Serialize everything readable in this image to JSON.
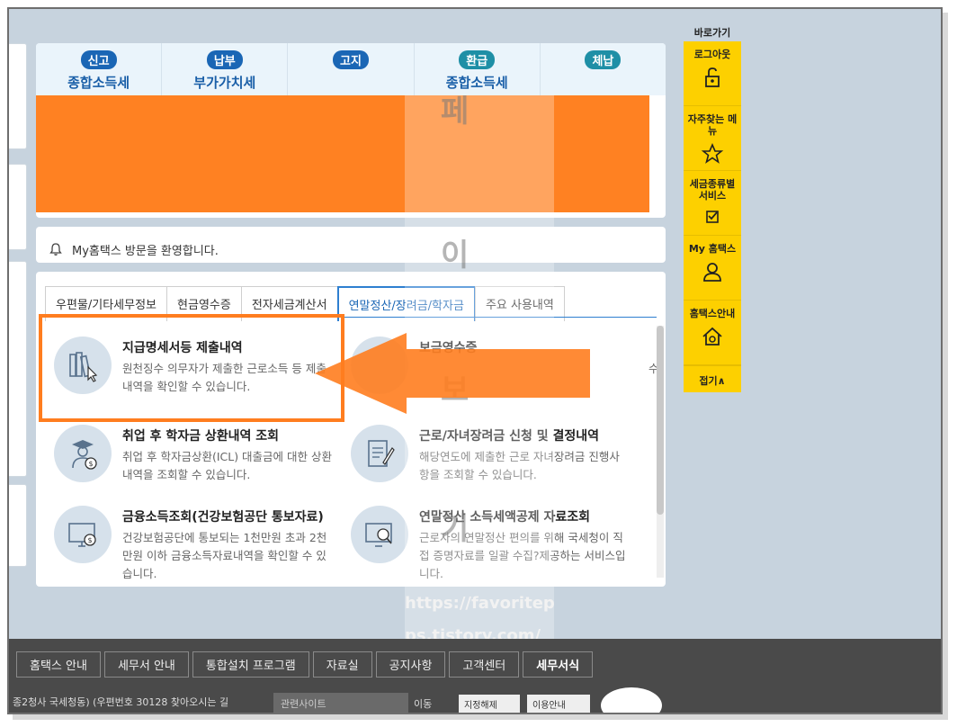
{
  "tax_tabs": [
    {
      "badge": "신고",
      "name": "종합소득세"
    },
    {
      "badge": "납부",
      "name": "부가가치세"
    },
    {
      "badge": "고지",
      "name": ""
    },
    {
      "badge": "환급",
      "name": "종합소득세"
    },
    {
      "badge": "체납",
      "name": ""
    }
  ],
  "welcome": {
    "text": "My홈택스 방문을 환영합니다."
  },
  "subtabs": [
    "우편물/기타세무정보",
    "현금영수증",
    "전자세금계산서",
    "연말정산/장려금/학자금",
    "주요 사용내역"
  ],
  "items": [
    {
      "title": "지급명세서등 제출내역",
      "desc": "원천징수 의무자가 제출한 근로소득 등 제출내역을 확인할 수 있습니다."
    },
    {
      "title": "보금영수증",
      "desc": "수"
    },
    {
      "title": "취업 후 학자금 상환내역 조회",
      "desc": "취업 후 학자금상환(ICL) 대출금에 대한 상환내역을 조회할 수 있습니다."
    },
    {
      "title": "근로/자녀장려금 신청 및 결정내역",
      "desc": "해당연도에 제출한 근로 자녀장려금 진행사항을 조회할 수 있습니다."
    },
    {
      "title": "금융소득조회(건강보험공단 통보자료)",
      "desc": "건강보험공단에 통보되는 1천만원 초과 2천만원 이하 금융소득자료내역을 확인할 수 있습니다."
    },
    {
      "title": "연말정산 소득세액공제 자료조회",
      "desc": "근로자의 연말정산 편의를 위해 국세청이 직접 증명자료를 일괄 수집?제공하는 서비스입니다."
    }
  ],
  "watermark": {
    "chars": [
      "페",
      "이",
      "보",
      "기"
    ],
    "url1": "https://favoritep",
    "url2": "ps.tistory.com/"
  },
  "quick": {
    "title": "바로가기",
    "items": [
      "로그아웃",
      "자주찾는 메뉴",
      "세금종류별 서비스",
      "My 홈택스",
      "홈택스안내"
    ],
    "fold": "접기∧"
  },
  "footer": {
    "nav": [
      "홈택스 안내",
      "세무서 안내",
      "통합설치 프로그램",
      "자료실",
      "공지사항",
      "고객센터",
      "세무서식"
    ],
    "info": "종2청사 국세청동) (우편번호 30128    찾아오시는 길",
    "site": "관련사이트",
    "go": "이동",
    "btn1": "지정해제",
    "btn2": "이용안내"
  },
  "colors": {
    "accent": "#1a66b5",
    "highlight": "#ff7d1f",
    "quick": "#fdd000"
  }
}
